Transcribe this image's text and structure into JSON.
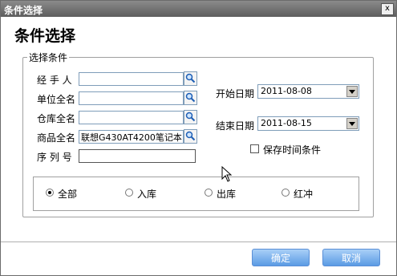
{
  "window": {
    "title": "条件选择",
    "close_glyph": "x"
  },
  "heading": "条件选择",
  "group": {
    "legend": "选择条件"
  },
  "fields": {
    "handler": {
      "label": "经 手 人",
      "value": ""
    },
    "company": {
      "label": "单位全名",
      "value": ""
    },
    "warehouse": {
      "label": "仓库全名",
      "value": ""
    },
    "product": {
      "label": "商品全名",
      "value": "联想G430AT4200笔记本"
    },
    "serial": {
      "label": "序 列 号",
      "value": ""
    }
  },
  "dates": {
    "start": {
      "label": "开始日期",
      "value": "2011-08-08"
    },
    "end": {
      "label": "结束日期",
      "value": "2011-08-15"
    }
  },
  "save_time": {
    "label": "保存时间条件",
    "checked": false
  },
  "radios": {
    "all": "全部",
    "in": "入库",
    "out": "出库",
    "reverse": "红冲",
    "selected": "全部"
  },
  "buttons": {
    "ok": "确定",
    "cancel": "取消"
  }
}
